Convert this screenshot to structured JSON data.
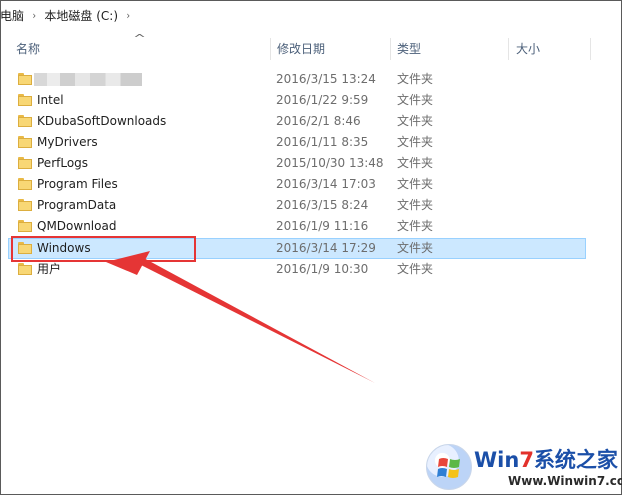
{
  "breadcrumb": {
    "items": [
      "电脑",
      "本地磁盘 (C:)"
    ],
    "separator": "›"
  },
  "columns": {
    "name": "名称",
    "date": "修改日期",
    "type": "类型",
    "size": "大小"
  },
  "rows": [
    {
      "name": "",
      "date": "2016/3/15 13:24",
      "type": "文件夹",
      "redacted": true
    },
    {
      "name": "Intel",
      "date": "2016/1/22 9:59",
      "type": "文件夹"
    },
    {
      "name": "KDubaSoftDownloads",
      "date": "2016/2/1 8:46",
      "type": "文件夹"
    },
    {
      "name": "MyDrivers",
      "date": "2016/1/11 8:35",
      "type": "文件夹"
    },
    {
      "name": "PerfLogs",
      "date": "2015/10/30 13:48",
      "type": "文件夹"
    },
    {
      "name": "Program Files",
      "date": "2016/3/14 17:03",
      "type": "文件夹"
    },
    {
      "name": "ProgramData",
      "date": "2016/3/15 8:24",
      "type": "文件夹"
    },
    {
      "name": "QMDownload",
      "date": "2016/1/9 11:16",
      "type": "文件夹"
    },
    {
      "name": "Windows",
      "date": "2016/3/14 17:29",
      "type": "文件夹",
      "selected": true
    },
    {
      "name": "用户",
      "date": "2016/1/9 10:30",
      "type": "文件夹"
    }
  ],
  "watermark": {
    "title_pre": "Win",
    "title_seven": "7",
    "title_post": "系统之家",
    "url": "Www.Winwin7.com"
  },
  "colors": {
    "selection_bg": "#cce8ff",
    "selection_border": "#99d1ff",
    "annotation_red": "#e53535",
    "folder_yellow": "#f8d775"
  },
  "icons": {
    "folder": "folder-icon",
    "sort": "sort-up-icon"
  }
}
